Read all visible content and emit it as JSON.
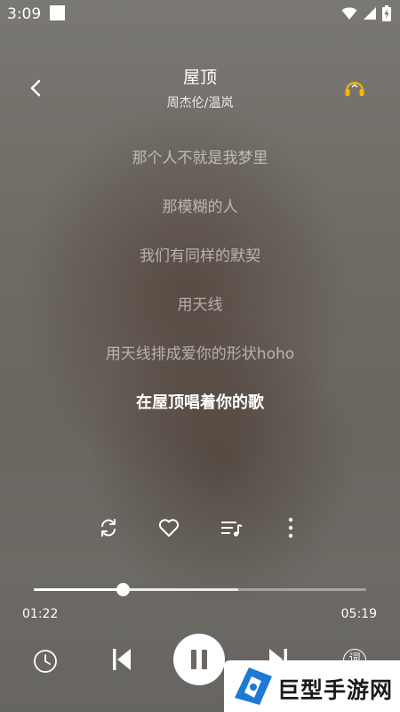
{
  "status_bar": {
    "time": "3:09"
  },
  "header": {
    "title": "屋顶",
    "artist": "周杰伦/温岚"
  },
  "lyrics": [
    "那个人不就是我梦里",
    "那模糊的人",
    "我们有同样的默契",
    "用天线",
    "用天线排成爱你的形状hoho",
    "在屋顶唱着你的歌"
  ],
  "current_lyric_index": 5,
  "player": {
    "current_time": "01:22",
    "total_time": "05:19",
    "progress_fraction": 0.268,
    "buffer_fraction": 0.614,
    "state": "playing"
  },
  "icons": {
    "back": "chevron-left-icon",
    "headphones": "headphones-icon",
    "repeat": "repeat-icon",
    "like": "heart-icon",
    "playlist": "playlist-icon",
    "more": "more-vertical-icon",
    "timer": "clock-icon",
    "previous": "skip-previous-icon",
    "pause": "pause-icon",
    "next": "skip-next-icon",
    "lyrics": "lyrics-icon"
  },
  "lyrics_button_label": "词",
  "watermark": {
    "text": "巨型手游网"
  },
  "colors": {
    "accent_headphone": "#f5b400",
    "watermark_logo": "#1e78d6"
  }
}
